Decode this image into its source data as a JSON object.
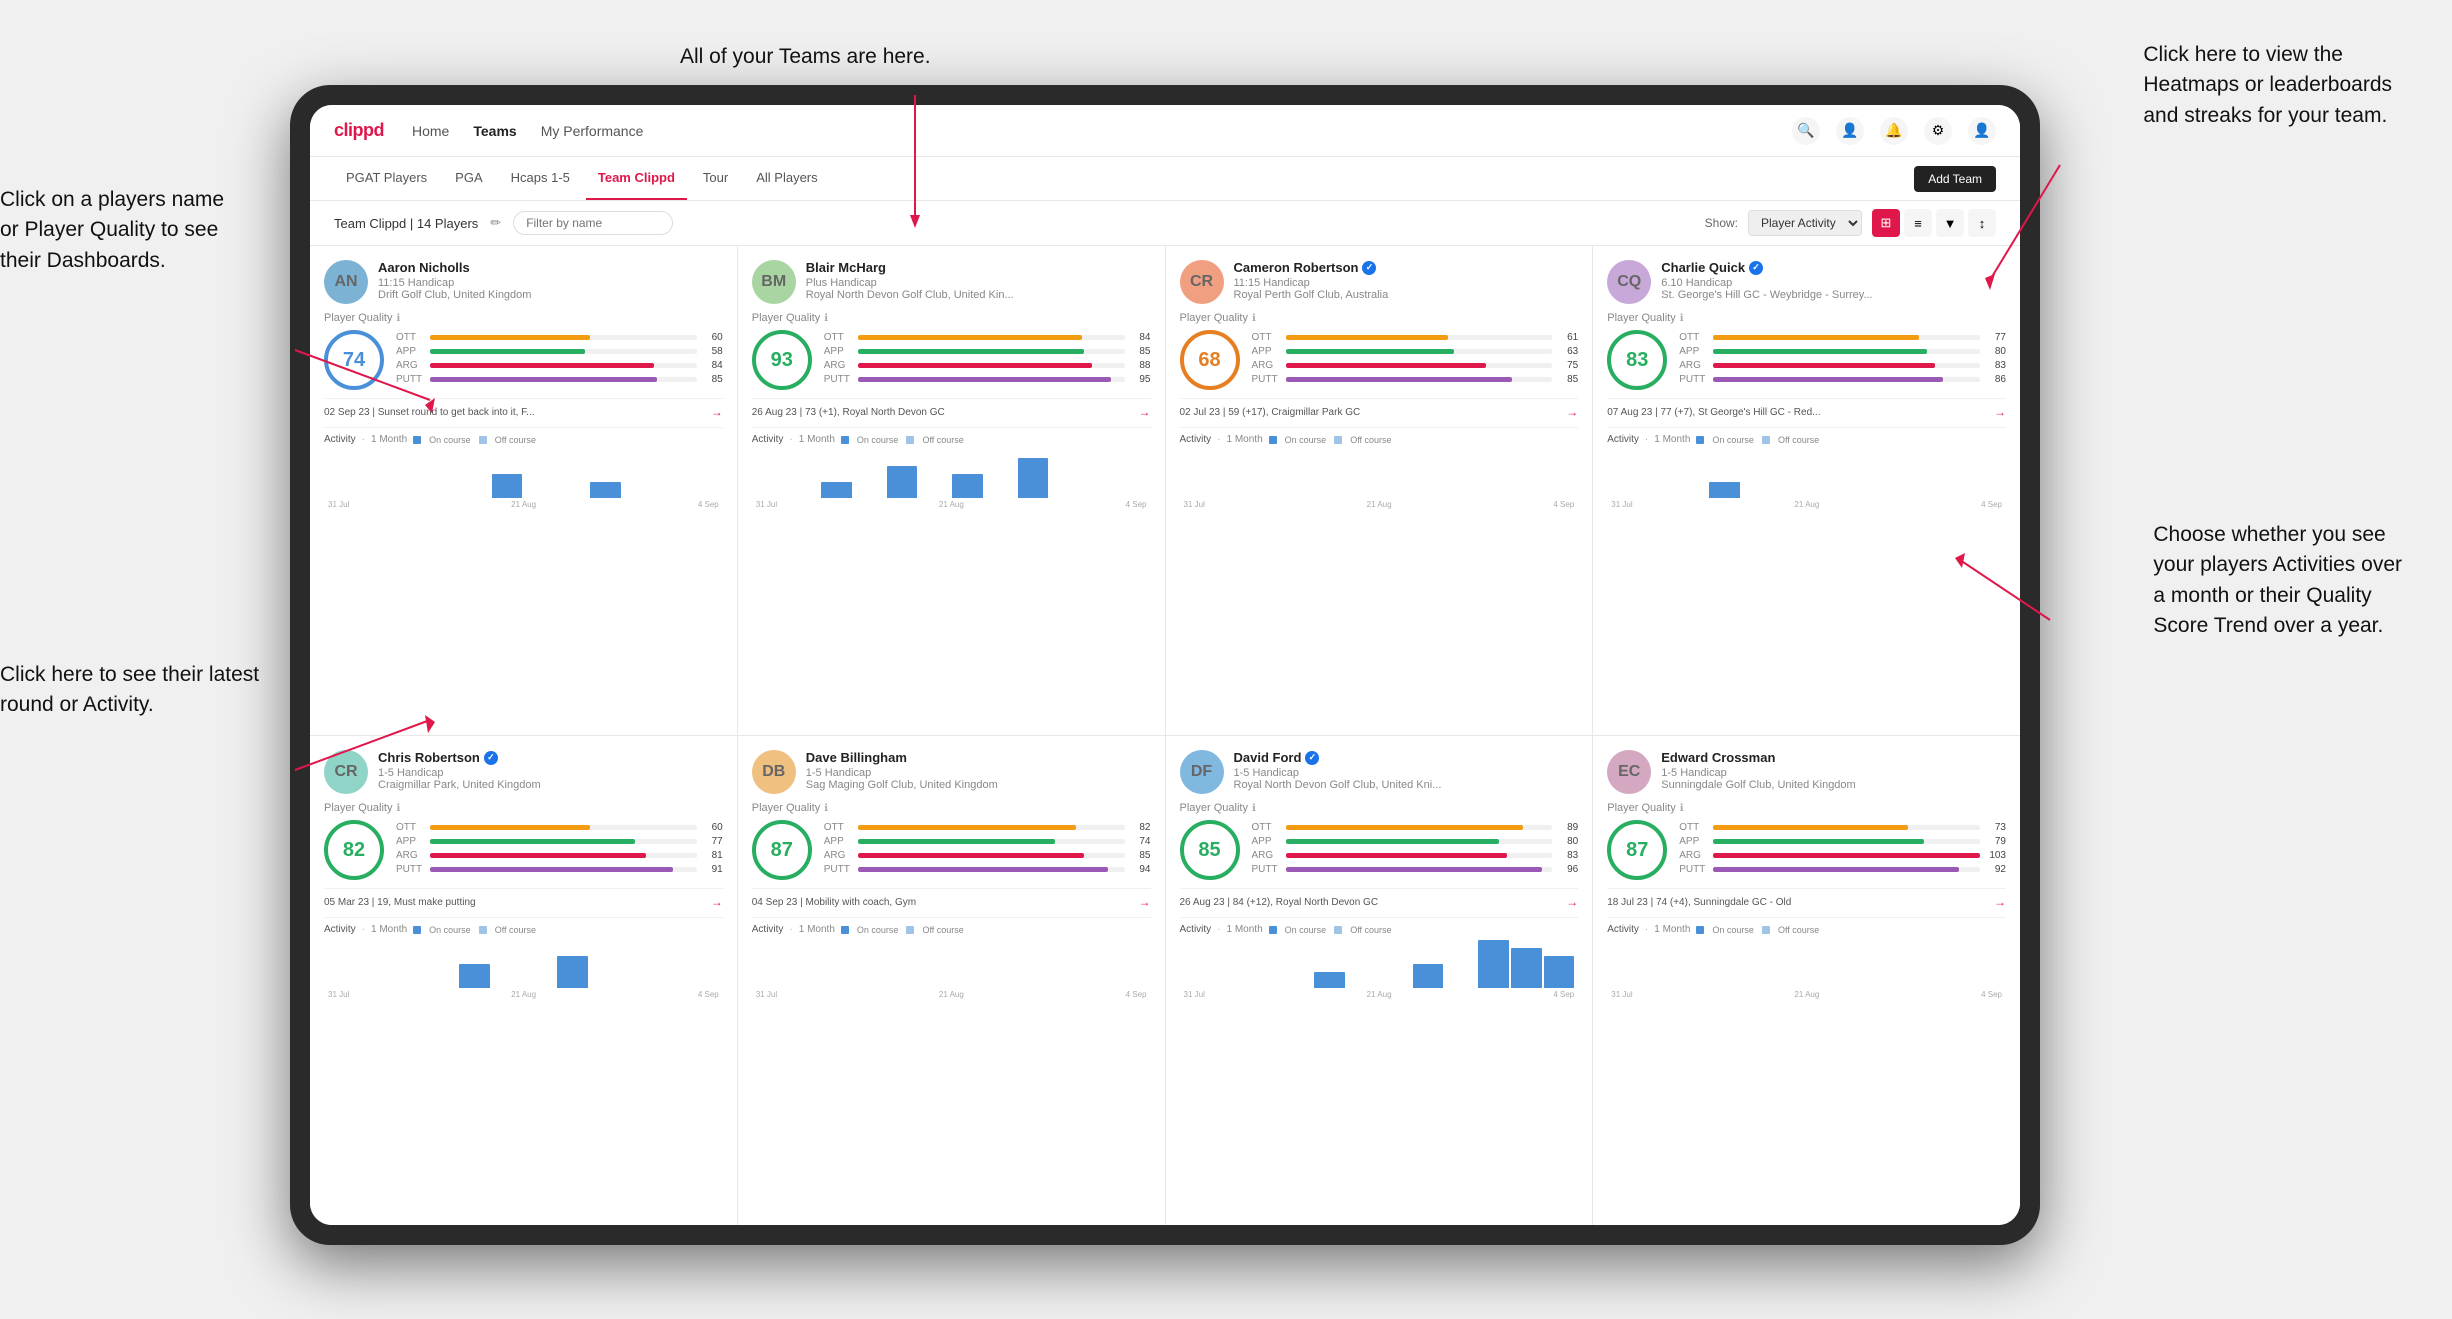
{
  "annotations": {
    "teams_arrow": "All of your Teams are here.",
    "heatmaps_arrow": "Click here to view the\nHeatmaps or leaderboards\nand streaks for your team.",
    "player_name": "Click on a players name\nor Player Quality to see\ntheir Dashboards.",
    "latest_round": "Click here to see their latest\nround or Activity.",
    "activities": "Choose whether you see\nyour players Activities over\na month or their Quality\nScore Trend over a year."
  },
  "nav": {
    "logo": "clippd",
    "links": [
      "Home",
      "Teams",
      "My Performance"
    ],
    "active": "Teams"
  },
  "subnav": {
    "tabs": [
      "PGAT Players",
      "PGA",
      "Hcaps 1-5",
      "Team Clippd",
      "Tour",
      "All Players"
    ],
    "active": "Team Clippd",
    "add_button": "Add Team"
  },
  "toolbar": {
    "team_label": "Team Clippd | 14 Players",
    "filter_placeholder": "Filter by name",
    "show_label": "Show:",
    "show_option": "Player Activity",
    "view_options": [
      "grid2",
      "grid3",
      "filter",
      "sort"
    ]
  },
  "players": [
    {
      "name": "Aaron Nicholls",
      "handicap": "11:15 Handicap",
      "club": "Drift Golf Club, United Kingdom",
      "verified": false,
      "initials": "AN",
      "score": 74,
      "ring_class": "ring-74",
      "stats": [
        {
          "label": "OTT",
          "value": 60,
          "color": "bar-ott"
        },
        {
          "label": "APP",
          "value": 58,
          "color": "bar-app"
        },
        {
          "label": "ARG",
          "value": 84,
          "color": "bar-arg"
        },
        {
          "label": "PUTT",
          "value": 85,
          "color": "bar-putt"
        }
      ],
      "recent": "02 Sep 23 | Sunset round to get back into it, F...",
      "activity_bars": [
        0,
        0,
        0,
        0,
        0,
        3,
        0,
        0,
        2,
        0,
        0,
        0
      ],
      "dates": [
        "31 Jul",
        "21 Aug",
        "4 Sep"
      ]
    },
    {
      "name": "Blair McHarg",
      "handicap": "Plus Handicap",
      "club": "Royal North Devon Golf Club, United Kin...",
      "verified": false,
      "initials": "BM",
      "score": 93,
      "ring_class": "ring-93",
      "stats": [
        {
          "label": "OTT",
          "value": 84,
          "color": "bar-ott"
        },
        {
          "label": "APP",
          "value": 85,
          "color": "bar-app"
        },
        {
          "label": "ARG",
          "value": 88,
          "color": "bar-arg"
        },
        {
          "label": "PUTT",
          "value": 95,
          "color": "bar-putt"
        }
      ],
      "recent": "26 Aug 23 | 73 (+1), Royal North Devon GC",
      "activity_bars": [
        0,
        0,
        2,
        0,
        4,
        0,
        3,
        0,
        5,
        0,
        0,
        0
      ],
      "dates": [
        "31 Jul",
        "21 Aug",
        "4 Sep"
      ]
    },
    {
      "name": "Cameron Robertson",
      "handicap": "11:15 Handicap",
      "club": "Royal Perth Golf Club, Australia",
      "verified": true,
      "initials": "CR",
      "score": 68,
      "ring_class": "ring-68",
      "stats": [
        {
          "label": "OTT",
          "value": 61,
          "color": "bar-ott"
        },
        {
          "label": "APP",
          "value": 63,
          "color": "bar-app"
        },
        {
          "label": "ARG",
          "value": 75,
          "color": "bar-arg"
        },
        {
          "label": "PUTT",
          "value": 85,
          "color": "bar-putt"
        }
      ],
      "recent": "02 Jul 23 | 59 (+17), Craigmillar Park GC",
      "activity_bars": [
        0,
        0,
        0,
        0,
        0,
        0,
        0,
        0,
        0,
        0,
        0,
        0
      ],
      "dates": [
        "31 Jul",
        "21 Aug",
        "4 Sep"
      ]
    },
    {
      "name": "Charlie Quick",
      "handicap": "6.10 Handicap",
      "club": "St. George's Hill GC - Weybridge - Surrey...",
      "verified": true,
      "initials": "CQ",
      "score": 83,
      "ring_class": "ring-83",
      "stats": [
        {
          "label": "OTT",
          "value": 77,
          "color": "bar-ott"
        },
        {
          "label": "APP",
          "value": 80,
          "color": "bar-app"
        },
        {
          "label": "ARG",
          "value": 83,
          "color": "bar-arg"
        },
        {
          "label": "PUTT",
          "value": 86,
          "color": "bar-putt"
        }
      ],
      "recent": "07 Aug 23 | 77 (+7), St George's Hill GC - Red...",
      "activity_bars": [
        0,
        0,
        0,
        2,
        0,
        0,
        0,
        0,
        0,
        0,
        0,
        0
      ],
      "dates": [
        "31 Jul",
        "21 Aug",
        "4 Sep"
      ]
    },
    {
      "name": "Chris Robertson",
      "handicap": "1-5 Handicap",
      "club": "Craigmillar Park, United Kingdom",
      "verified": true,
      "initials": "CR2",
      "score": 82,
      "ring_class": "ring-82",
      "stats": [
        {
          "label": "OTT",
          "value": 60,
          "color": "bar-ott"
        },
        {
          "label": "APP",
          "value": 77,
          "color": "bar-app"
        },
        {
          "label": "ARG",
          "value": 81,
          "color": "bar-arg"
        },
        {
          "label": "PUTT",
          "value": 91,
          "color": "bar-putt"
        }
      ],
      "recent": "05 Mar 23 | 19, Must make putting",
      "activity_bars": [
        0,
        0,
        0,
        0,
        3,
        0,
        0,
        4,
        0,
        0,
        0,
        0
      ],
      "dates": [
        "31 Jul",
        "21 Aug",
        "4 Sep"
      ]
    },
    {
      "name": "Dave Billingham",
      "handicap": "1-5 Handicap",
      "club": "Sag Maging Golf Club, United Kingdom",
      "verified": false,
      "initials": "DB",
      "score": 87,
      "ring_class": "ring-87",
      "stats": [
        {
          "label": "OTT",
          "value": 82,
          "color": "bar-ott"
        },
        {
          "label": "APP",
          "value": 74,
          "color": "bar-app"
        },
        {
          "label": "ARG",
          "value": 85,
          "color": "bar-arg"
        },
        {
          "label": "PUTT",
          "value": 94,
          "color": "bar-putt"
        }
      ],
      "recent": "04 Sep 23 | Mobility with coach, Gym",
      "activity_bars": [
        0,
        0,
        0,
        0,
        0,
        0,
        0,
        0,
        0,
        0,
        0,
        0
      ],
      "dates": [
        "31 Jul",
        "21 Aug",
        "4 Sep"
      ]
    },
    {
      "name": "David Ford",
      "handicap": "1-5 Handicap",
      "club": "Royal North Devon Golf Club, United Kni...",
      "verified": true,
      "initials": "DF",
      "score": 85,
      "ring_class": "ring-85",
      "stats": [
        {
          "label": "OTT",
          "value": 89,
          "color": "bar-ott"
        },
        {
          "label": "APP",
          "value": 80,
          "color": "bar-app"
        },
        {
          "label": "ARG",
          "value": 83,
          "color": "bar-arg"
        },
        {
          "label": "PUTT",
          "value": 96,
          "color": "bar-putt"
        }
      ],
      "recent": "26 Aug 23 | 84 (+12), Royal North Devon GC",
      "activity_bars": [
        0,
        0,
        0,
        0,
        2,
        0,
        0,
        3,
        0,
        6,
        5,
        4
      ],
      "dates": [
        "31 Jul",
        "21 Aug",
        "4 Sep"
      ]
    },
    {
      "name": "Edward Crossman",
      "handicap": "1-5 Handicap",
      "club": "Sunningdale Golf Club, United Kingdom",
      "verified": false,
      "initials": "EC",
      "score": 87,
      "ring_class": "ring-87",
      "stats": [
        {
          "label": "OTT",
          "value": 73,
          "color": "bar-ott"
        },
        {
          "label": "APP",
          "value": 79,
          "color": "bar-app"
        },
        {
          "label": "ARG",
          "value": 103,
          "color": "bar-arg"
        },
        {
          "label": "PUTT",
          "value": 92,
          "color": "bar-putt"
        }
      ],
      "recent": "18 Jul 23 | 74 (+4), Sunningdale GC - Old",
      "activity_bars": [
        0,
        0,
        0,
        0,
        0,
        0,
        0,
        0,
        0,
        0,
        0,
        0
      ],
      "dates": [
        "31 Jul",
        "21 Aug",
        "4 Sep"
      ]
    }
  ]
}
